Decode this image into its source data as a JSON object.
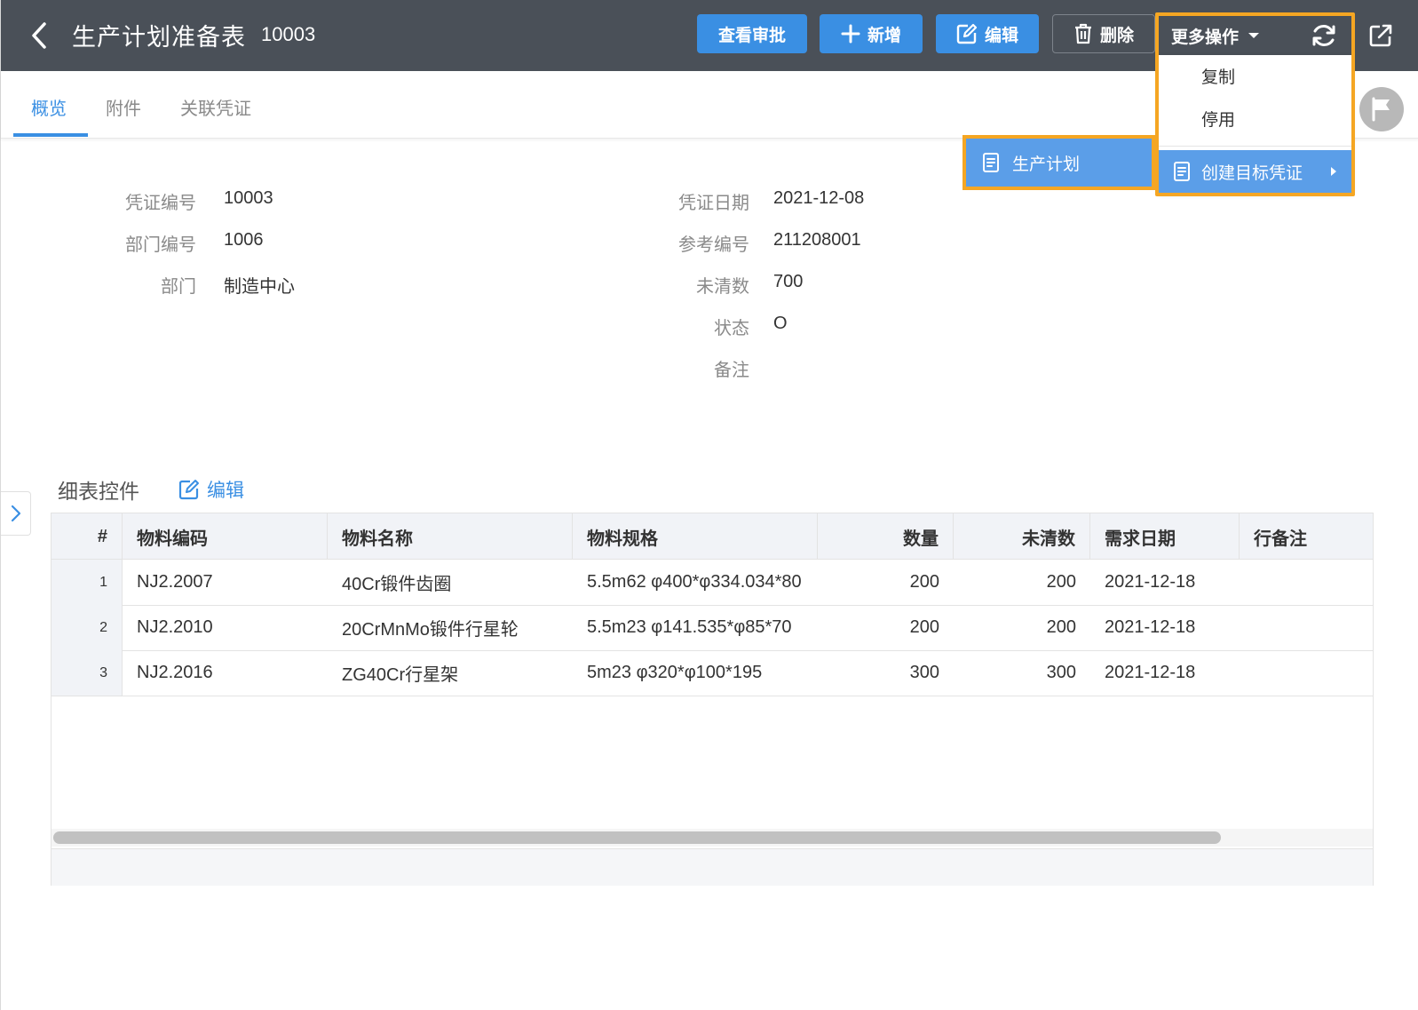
{
  "header": {
    "title": "生产计划准备表",
    "doc_no": "10003",
    "buttons": {
      "view_approval": "查看审批",
      "add": "新增",
      "edit": "编辑",
      "delete": "删除",
      "more": "更多操作"
    }
  },
  "more_menu": {
    "items": [
      "复制",
      "停用"
    ],
    "create_target": "创建目标凭证",
    "submenu": [
      "生产计划"
    ]
  },
  "tabs": [
    "概览",
    "附件",
    "关联凭证"
  ],
  "active_tab": "概览",
  "form": {
    "left": [
      {
        "label": "凭证编号",
        "value": "10003"
      },
      {
        "label": "部门编号",
        "value": "1006"
      },
      {
        "label": "部门",
        "value": "制造中心"
      }
    ],
    "right": [
      {
        "label": "凭证日期",
        "value": "2021-12-08"
      },
      {
        "label": "参考编号",
        "value": "211208001"
      },
      {
        "label": "未清数",
        "value": "700"
      },
      {
        "label": "状态",
        "value": "O"
      },
      {
        "label": "备注",
        "value": ""
      }
    ]
  },
  "detail": {
    "title": "细表控件",
    "edit_label": "编辑",
    "columns": [
      "#",
      "物料编码",
      "物料名称",
      "物料规格",
      "数量",
      "未清数",
      "需求日期",
      "行备注"
    ],
    "rows": [
      {
        "idx": "1",
        "code": "NJ2.2007",
        "name": "40Cr锻件齿圈",
        "spec": "5.5m62 φ400*φ334.034*80",
        "qty": "200",
        "open": "200",
        "date": "2021-12-18",
        "remark": ""
      },
      {
        "idx": "2",
        "code": "NJ2.2010",
        "name": "20CrMnMo锻件行星轮",
        "spec": "5.5m23 φ141.535*φ85*70",
        "qty": "200",
        "open": "200",
        "date": "2021-12-18",
        "remark": ""
      },
      {
        "idx": "3",
        "code": "NJ2.2016",
        "name": "ZG40Cr行星架",
        "spec": "5m23 φ320*φ100*195",
        "qty": "300",
        "open": "300",
        "date": "2021-12-18",
        "remark": ""
      }
    ]
  },
  "colors": {
    "header_bg": "#4a5058",
    "primary": "#3a8fe3",
    "menu_highlight": "#5b9ee8",
    "callout": "#f5a623"
  }
}
